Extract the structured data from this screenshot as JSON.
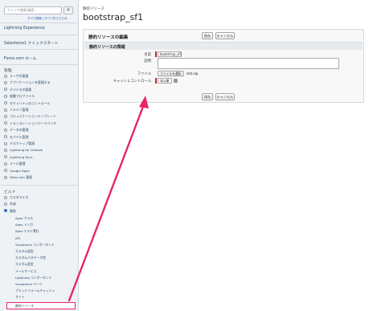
{
  "sidebar": {
    "search_placeholder": "クイック検索/検索...",
    "expand_all": "すべて展開",
    "collapse_all": "すべて折りたたみ",
    "links": [
      "Lightning Experience",
      "Salesforce1 クイックスタート",
      "Force.com ホーム"
    ],
    "admin_heading": "管理",
    "admin_items": [
      "ユーザの管理",
      "アプリケーションを管理する",
      "デバイスの管理",
      "組織プロファイル",
      "セキュリティのコントロール",
      "ドメイン管理",
      "コミュニケーションテンプレート",
      "トランスレーションワークベンチ",
      "データの管理",
      "モバイル管理",
      "デスクトップ管理",
      "Lightning for Outlook",
      "Lightning Sync",
      "メール管理",
      "Google Apps",
      "Data.com 管理"
    ],
    "build_heading": "ビルド",
    "build_items": [
      "カスタマイズ",
      "作成",
      "開発"
    ],
    "develop_subitems": [
      "Apex クラス",
      "Apex トリガ",
      "Apex テスト実行",
      "API",
      "Visualforce コンポーネント",
      "カスタム設定",
      "カスタムメタデータ型",
      "カスタム設定",
      "メールサービス",
      "Lightning コンポーネント",
      "Visualforce ページ",
      "プラットフォームキャッシュ",
      "サイト"
    ],
    "selected_item": "静的リソース"
  },
  "main": {
    "breadcrumb": "静的リソース",
    "page_title": "bootstrap_sf1",
    "save_label": "保存",
    "cancel_label": "キャンセル",
    "edit_title": "静的リソースの編集",
    "section_title": "静的リソースの情報",
    "fields": {
      "name_label": "名前",
      "name_value": "bootstrap_sf1",
      "description_label": "説明",
      "description_value": "",
      "file_label": "ファイル",
      "file_button": "ファイルを選択",
      "file_name": "dist.zip",
      "cache_label": "キャッシュコントロール",
      "cache_value": "非公開"
    }
  },
  "colors": {
    "arrow": "#e8246b",
    "sidebar_bg": "#eef2f5",
    "link": "#1f3d5c",
    "required": "#c0282d"
  },
  "icons": [
    "search-icon",
    "info-icon",
    "expand-icon",
    "arrow-annotation"
  ]
}
